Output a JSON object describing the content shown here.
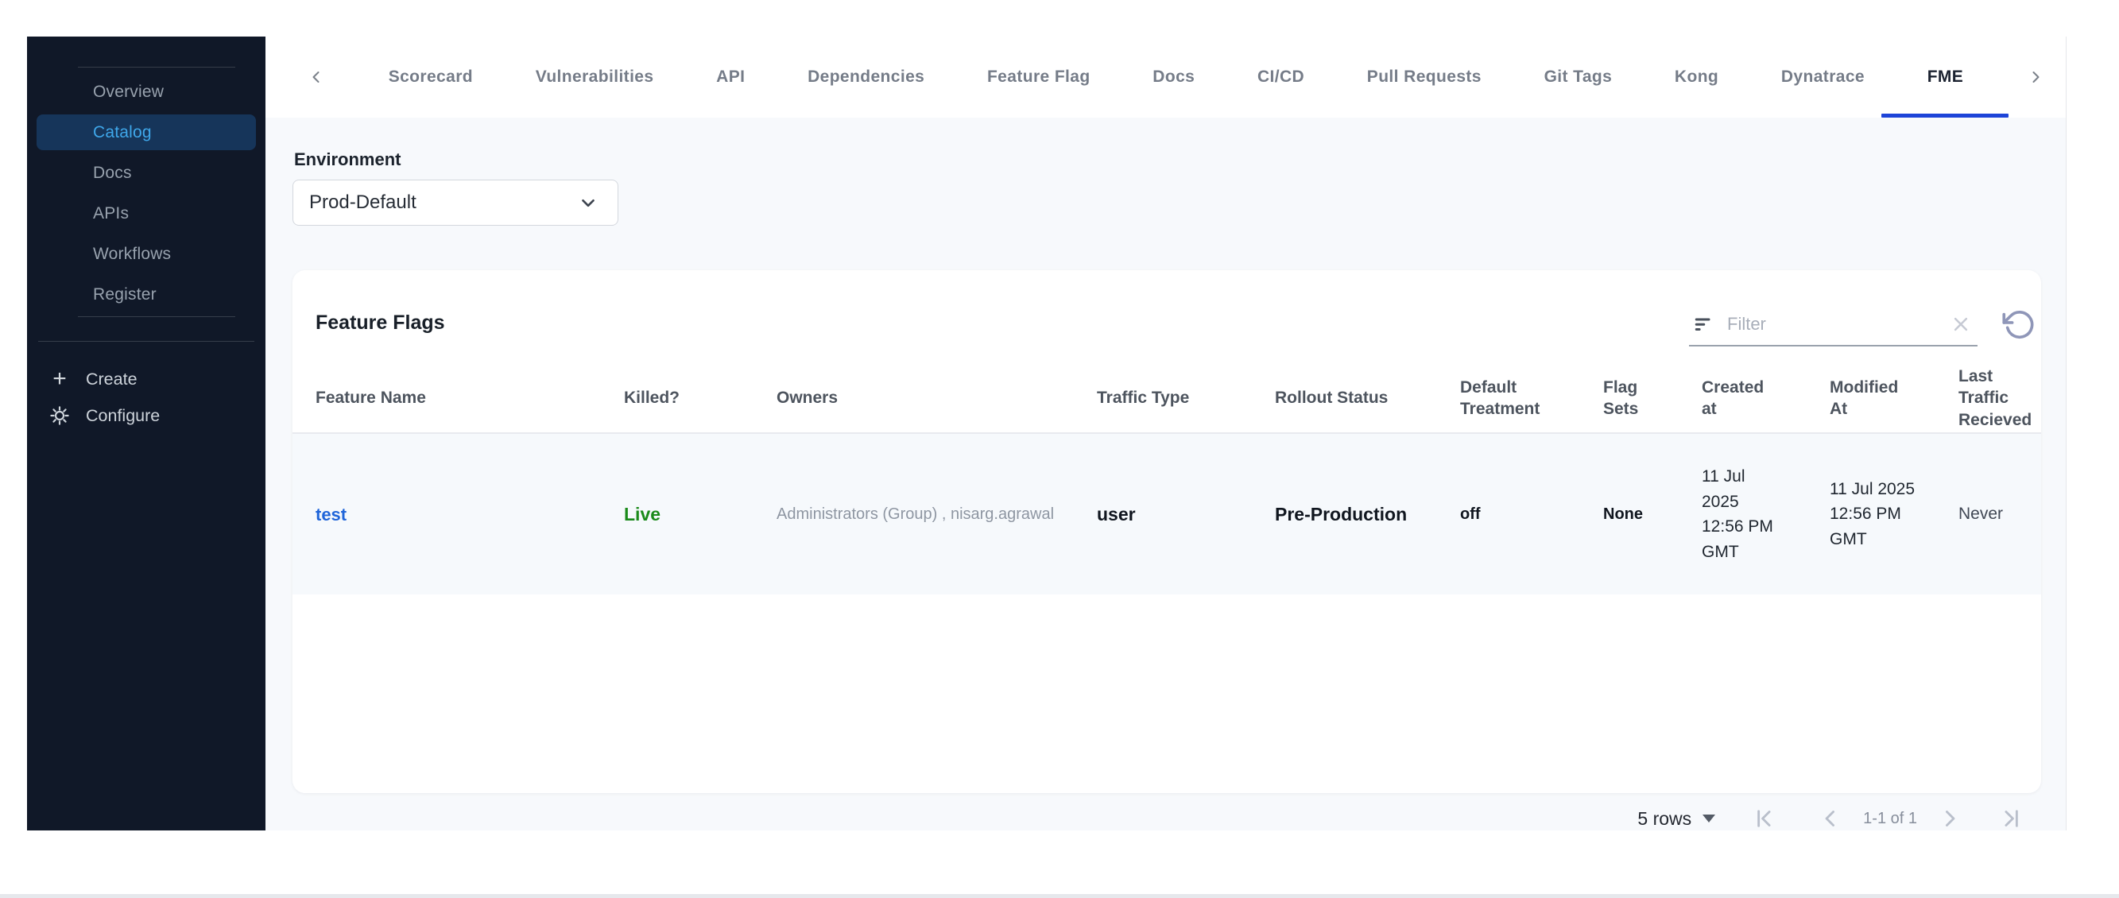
{
  "sidebar": {
    "items": [
      {
        "label": "Overview"
      },
      {
        "label": "Catalog"
      },
      {
        "label": "Docs"
      },
      {
        "label": "APIs"
      },
      {
        "label": "Workflows"
      },
      {
        "label": "Register"
      }
    ],
    "active_item": "Catalog",
    "create_label": "Create",
    "configure_label": "Configure"
  },
  "tabs": {
    "items": [
      "Scorecard",
      "Vulnerabilities",
      "API",
      "Dependencies",
      "Feature Flag",
      "Docs",
      "CI/CD",
      "Pull Requests",
      "Git Tags",
      "Kong",
      "Dynatrace",
      "FME"
    ],
    "active": "FME"
  },
  "environment": {
    "label": "Environment",
    "selected": "Prod-Default"
  },
  "feature_flags": {
    "title": "Feature Flags",
    "filter_placeholder": "Filter",
    "columns": [
      "Feature Name",
      "Killed?",
      "Owners",
      "Traffic Type",
      "Rollout Status",
      "Default Treatment",
      "Flag Sets",
      "Created at",
      "Modified At",
      "Last Traffic Recieved"
    ],
    "rows": [
      {
        "feature_name": "test",
        "killed": "Live",
        "owners": "Administrators (Group) , nisarg.agrawal",
        "traffic_type": "user",
        "rollout_status": "Pre-Production",
        "default_treatment": "off",
        "flag_sets": "None",
        "created_at": "11 Jul 2025 12:56 PM GMT",
        "modified_at": "11 Jul 2025 12:56 PM GMT",
        "last_traffic_recieved": "Never"
      }
    ]
  },
  "pagination": {
    "rows_per_page": "5 rows",
    "range": "1-1 of 1"
  },
  "colors": {
    "accent_blue": "#1d44d8",
    "link_blue": "#2065d9",
    "live_green": "#1a8a1a",
    "sidebar_bg": "#101828",
    "sidebar_active_text": "#3fa7ea",
    "content_bg": "#f7f9fc"
  }
}
